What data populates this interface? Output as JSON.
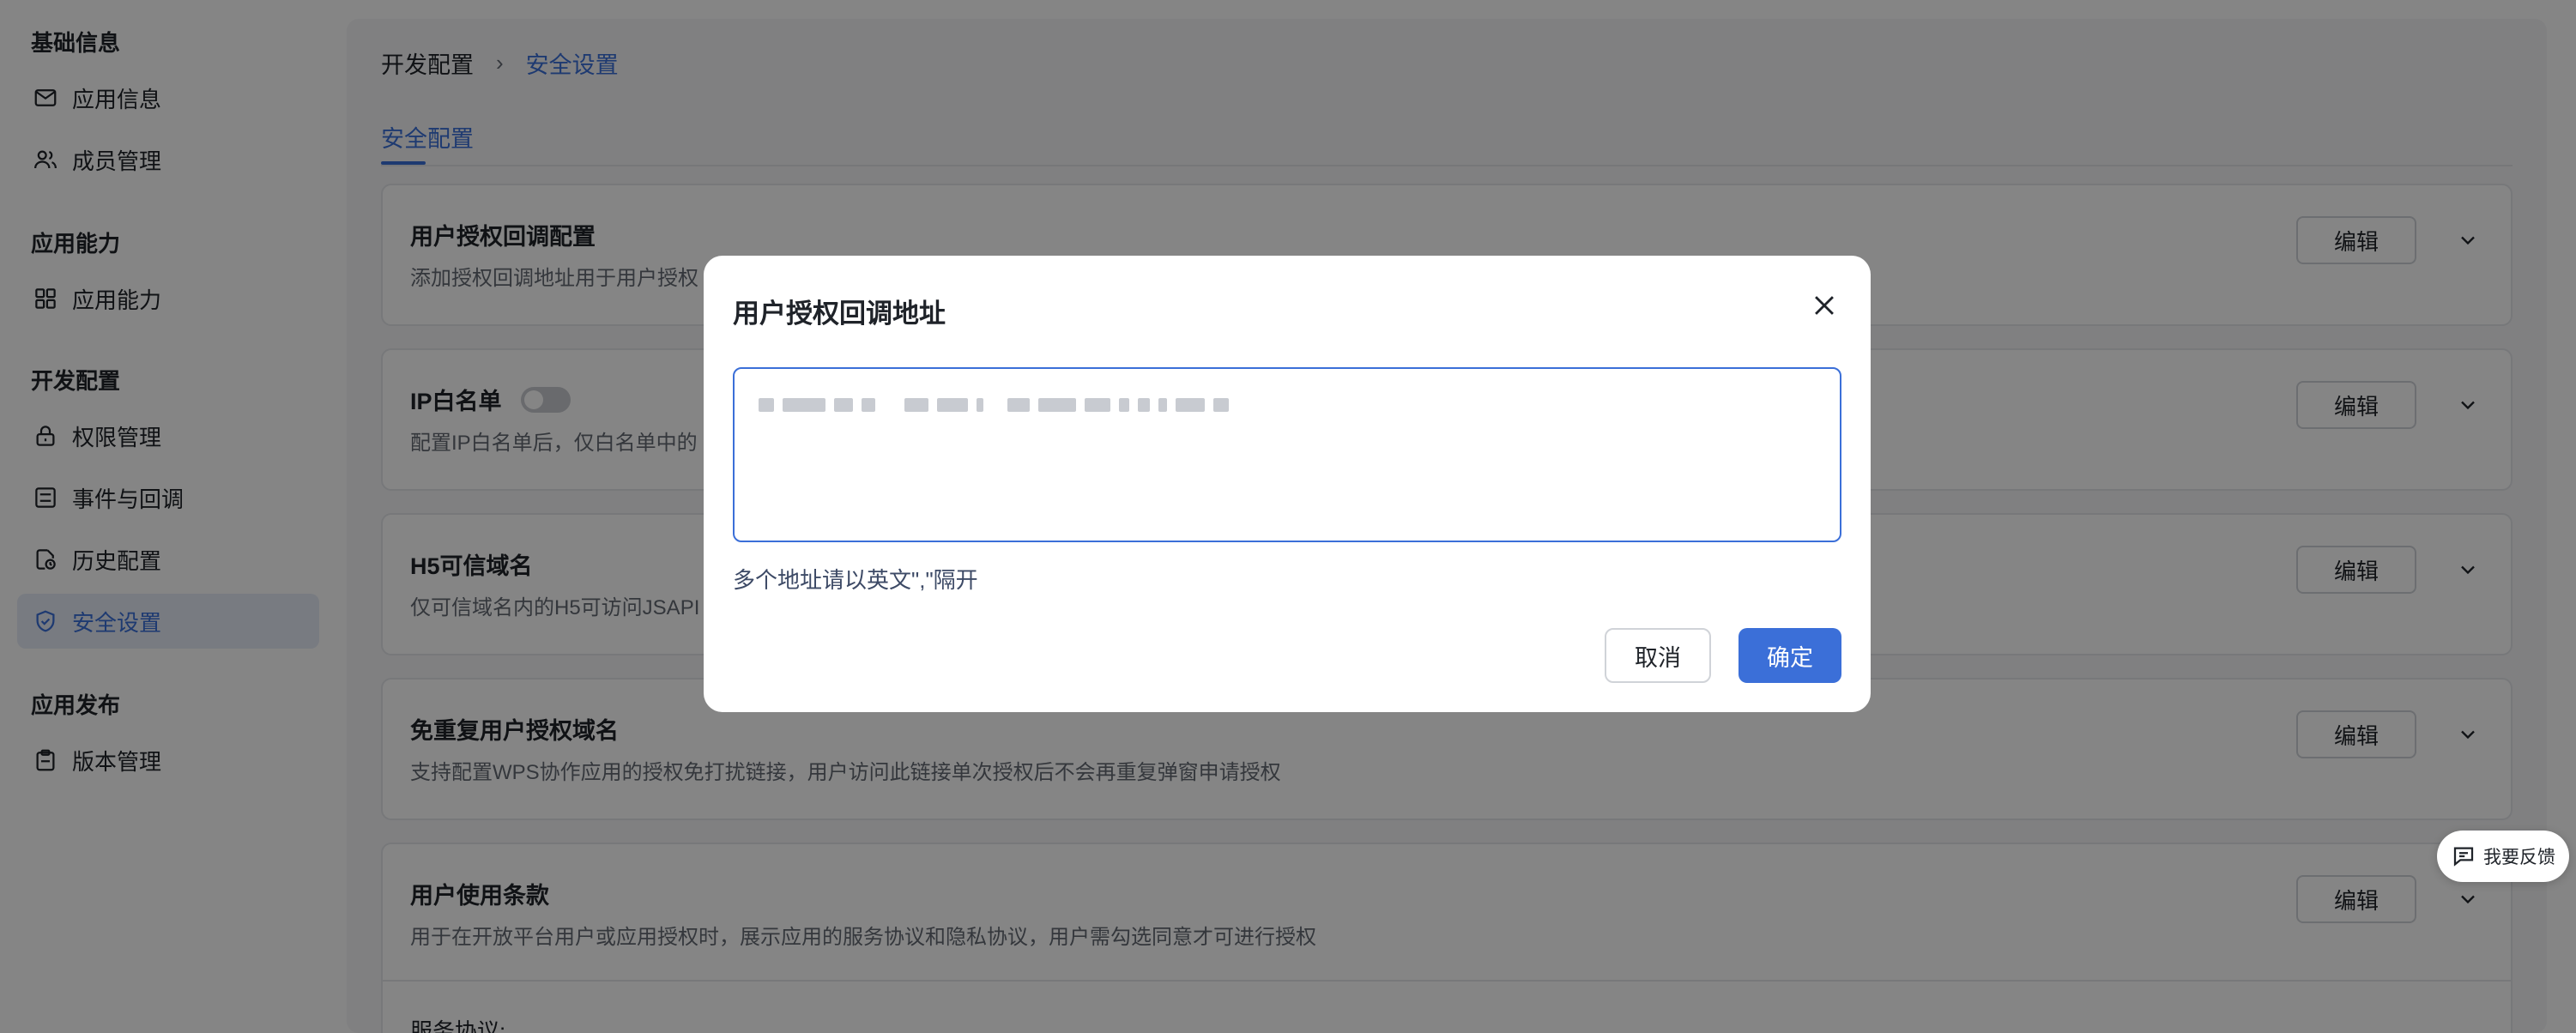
{
  "sidebar": {
    "sections": [
      {
        "title": "基础信息",
        "items": [
          {
            "label": "应用信息",
            "icon": "mail-icon",
            "active": false
          },
          {
            "label": "成员管理",
            "icon": "users-icon",
            "active": false
          }
        ]
      },
      {
        "title": "应用能力",
        "items": [
          {
            "label": "应用能力",
            "icon": "grid-icon",
            "active": false
          }
        ]
      },
      {
        "title": "开发配置",
        "items": [
          {
            "label": "权限管理",
            "icon": "lock-icon",
            "active": false
          },
          {
            "label": "事件与回调",
            "icon": "list-icon",
            "active": false
          },
          {
            "label": "历史配置",
            "icon": "history-icon",
            "active": false
          },
          {
            "label": "安全设置",
            "icon": "shield-icon",
            "active": true
          }
        ]
      },
      {
        "title": "应用发布",
        "items": [
          {
            "label": "版本管理",
            "icon": "clipboard-icon",
            "active": false
          }
        ]
      }
    ]
  },
  "breadcrumb": {
    "parent": "开发配置",
    "separator": "›",
    "current": "安全设置"
  },
  "tabs": [
    {
      "label": "安全配置",
      "active": true
    }
  ],
  "cards": [
    {
      "title": "用户授权回调配置",
      "desc": "添加授权回调地址用于用户授权",
      "edit": "编辑"
    },
    {
      "title": "IP白名单",
      "desc": "配置IP白名单后，仅白名单中的",
      "edit": "编辑",
      "toggle": false
    },
    {
      "title": "H5可信域名",
      "desc": "仅可信域名内的H5可访问JSAPI",
      "edit": "编辑"
    },
    {
      "title": "免重复用户授权域名",
      "desc": "支持配置WPS协作应用的授权免打扰链接，用户访问此链接单次授权后不会再重复弹窗申请授权",
      "edit": "编辑"
    },
    {
      "title": "用户使用条款",
      "desc": "用于在开放平台用户或应用授权时，展示应用的服务协议和隐私协议，用户需勾选同意才可进行授权",
      "edit": "编辑",
      "sub": "服务协议:"
    }
  ],
  "feedback": {
    "label": "我要反馈",
    "icon": "feedback-icon"
  },
  "modal": {
    "title": "用户授权回调地址",
    "input_value": "",
    "hint": "多个地址请以英文\",\"隔开",
    "cancel": "取消",
    "confirm": "确定"
  },
  "colors": {
    "accent": "#3b6fd8",
    "overlay": "rgba(0,0,0,0.48)"
  }
}
